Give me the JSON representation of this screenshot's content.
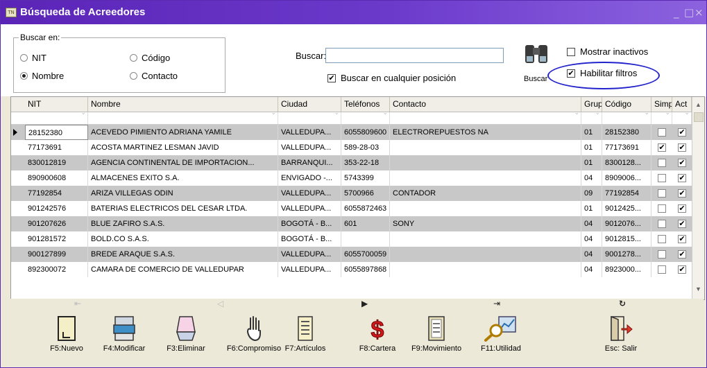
{
  "window": {
    "title": "Búsqueda de Acreedores",
    "app_icon": "TN",
    "minimize_glyph": "_",
    "maximize_glyph": "□",
    "close_glyph": "×"
  },
  "search_panel": {
    "group_label": "Buscar en:",
    "options": [
      {
        "label": "NIT",
        "selected": false
      },
      {
        "label": "Código",
        "selected": false
      },
      {
        "label": "Nombre",
        "selected": true
      },
      {
        "label": "Contacto",
        "selected": false
      }
    ],
    "search_label": "Buscar:",
    "search_value": "",
    "any_position_label": "Buscar en cualquier posición",
    "any_position_checked": true,
    "search_button_label": "Buscar",
    "show_inactive_label": "Mostrar inactivos",
    "show_inactive_checked": false,
    "enable_filters_label": "Habilitar filtros",
    "enable_filters_checked": true,
    "annotation_color": "#2222cc"
  },
  "grid": {
    "columns": [
      "NIT",
      "Nombre",
      "Ciudad",
      "Teléfonos",
      "Contacto",
      "Grup",
      "Código",
      "Simp",
      "Act"
    ],
    "rows": [
      {
        "nit": "28152380",
        "nombre": "ACEVEDO PIMIENTO ADRIANA YAMILE",
        "ciudad": "VALLEDUPA...",
        "telefonos": "6055809600",
        "contacto": "ELECTROREPUESTOS NA",
        "grupo": "01",
        "codigo": "28152380",
        "simp": false,
        "act": true
      },
      {
        "nit": "77173691",
        "nombre": "ACOSTA MARTINEZ LESMAN JAVID",
        "ciudad": "VALLEDUPA...",
        "telefonos": "589-28-03",
        "contacto": "",
        "grupo": "01",
        "codigo": "77173691",
        "simp": true,
        "act": true
      },
      {
        "nit": "830012819",
        "nombre": "AGENCIA CONTINENTAL DE IMPORTACION...",
        "ciudad": "BARRANQUI...",
        "telefonos": "353-22-18",
        "contacto": "",
        "grupo": "01",
        "codigo": "8300128...",
        "simp": false,
        "act": true
      },
      {
        "nit": "890900608",
        "nombre": "ALMACENES EXITO S.A.",
        "ciudad": "ENVIGADO -...",
        "telefonos": "5743399",
        "contacto": "",
        "grupo": "04",
        "codigo": "8909006...",
        "simp": false,
        "act": true
      },
      {
        "nit": "77192854",
        "nombre": "ARIZA VILLEGAS ODIN",
        "ciudad": "VALLEDUPA...",
        "telefonos": "5700966",
        "contacto": "CONTADOR",
        "grupo": "09",
        "codigo": "77192854",
        "simp": false,
        "act": true
      },
      {
        "nit": "901242576",
        "nombre": "BATERIAS ELECTRICOS DEL CESAR LTDA.",
        "ciudad": "VALLEDUPA...",
        "telefonos": "6055872463",
        "contacto": "",
        "grupo": "01",
        "codigo": "9012425...",
        "simp": false,
        "act": true
      },
      {
        "nit": "901207626",
        "nombre": "BLUE ZAFIRO S.A.S.",
        "ciudad": "BOGOTÁ - B...",
        "telefonos": "601",
        "contacto": "SONY",
        "grupo": "04",
        "codigo": "9012076...",
        "simp": false,
        "act": true
      },
      {
        "nit": "901281572",
        "nombre": "BOLD.CO S.A.S.",
        "ciudad": "BOGOTÁ - B...",
        "telefonos": "",
        "contacto": "",
        "grupo": "04",
        "codigo": "9012815...",
        "simp": false,
        "act": true
      },
      {
        "nit": "900127899",
        "nombre": "BREDE ARAQUE S.A.S.",
        "ciudad": "VALLEDUPA...",
        "telefonos": "6055700059",
        "contacto": "",
        "grupo": "04",
        "codigo": "9001278...",
        "simp": false,
        "act": true
      },
      {
        "nit": "892300072",
        "nombre": "CAMARA DE COMERCIO DE VALLEDUPAR",
        "ciudad": "VALLEDUPA...",
        "telefonos": "6055897868",
        "contacto": "",
        "grupo": "04",
        "codigo": "8923000...",
        "simp": false,
        "act": true
      }
    ],
    "nav": {
      "first": "⇤",
      "prior": "◁",
      "next": "▶",
      "last": "⇥",
      "refresh": "↻"
    }
  },
  "toolbar": {
    "buttons": [
      {
        "label": "F5:Nuevo",
        "icon": "new-doc-icon"
      },
      {
        "label": "F4:Modificar",
        "icon": "modify-icon"
      },
      {
        "label": "F3:Eliminar",
        "icon": "eraser-icon"
      },
      {
        "label": "F6:Compromiso",
        "icon": "hand-icon"
      },
      {
        "label": "F7:Artículos",
        "icon": "list-icon"
      },
      {
        "label": "F8:Cartera",
        "icon": "dollar-icon"
      },
      {
        "label": "F9:Movimiento",
        "icon": "ledger-icon"
      },
      {
        "label": "F11:Utilidad",
        "icon": "magnifier-chart-icon"
      },
      {
        "label": "Esc: Salir",
        "icon": "exit-door-icon"
      }
    ]
  }
}
